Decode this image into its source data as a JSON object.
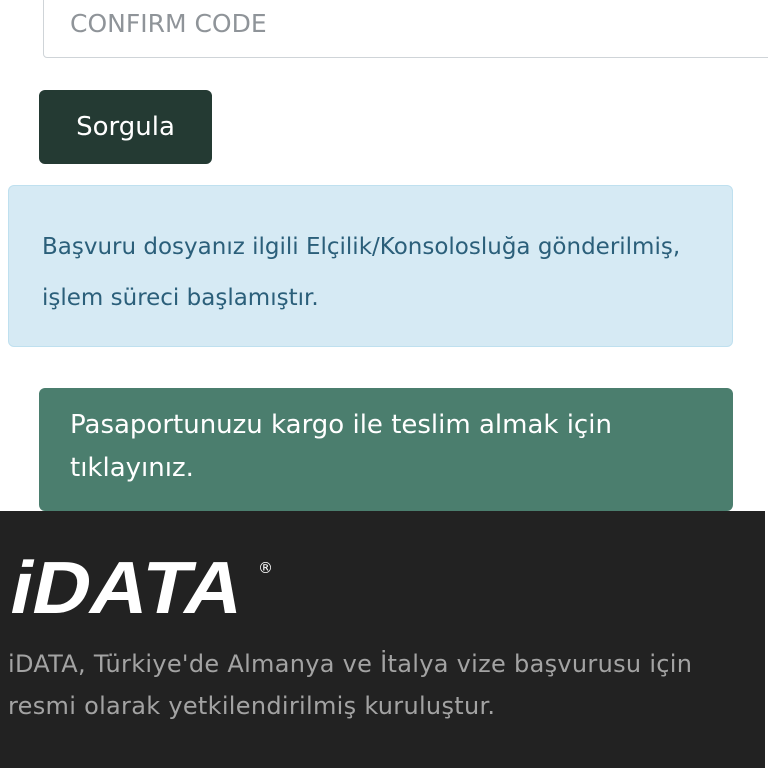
{
  "form": {
    "confirm_code_placeholder": "CONFIRM CODE",
    "query_button_label": "Sorgula"
  },
  "status_alert": {
    "message": "Başvuru dosyanız ilgili Elçilik/Konsolosluğa gönderilmiş, işlem süreci başlamıştır."
  },
  "kargo_link": {
    "label": "Pasaportunuzu kargo ile teslim almak için tıklayınız."
  },
  "footer": {
    "logo_text": "iDATA",
    "logo_mark": "®",
    "description": "iDATA, Türkiye'de Almanya ve İtalya vize başvurusu için resmi olarak yetkilendirilmiş kuruluştur."
  },
  "colors": {
    "button_dark_green": "#243a33",
    "alert_info_bg": "#d6eaf4",
    "alert_info_text": "#2b5f7a",
    "kargo_green": "#4b7e6e",
    "footer_bg": "#222222",
    "footer_text": "#a3a3a3"
  }
}
